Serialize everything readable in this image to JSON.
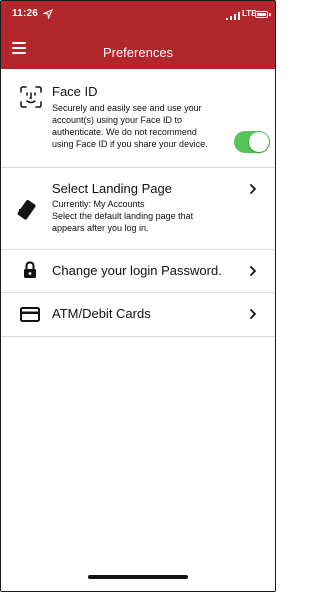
{
  "status_bar": {
    "time": "11:26",
    "network": "LTE"
  },
  "header": {
    "title": "Preferences"
  },
  "face_id": {
    "title": "Face ID",
    "description_lines": [
      "Securely and easily see and use your",
      "account(s) using your Face ID to",
      "authenticate.  We do not recommend",
      "using Face ID if you share your device."
    ],
    "enabled": true
  },
  "landing_page": {
    "title": "Select Landing Page",
    "current": "Currently: My Accounts",
    "description_lines": [
      "Select the default landing page that",
      "appears after you log in."
    ]
  },
  "password": {
    "title": "Change your login Password."
  },
  "cards": {
    "title": "ATM/Debit Cards"
  },
  "icons": {
    "menu": "menu-icon",
    "location": "location-arrow-icon",
    "signal": "signal-icon",
    "battery": "battery-icon",
    "face_id": "face-id-icon",
    "landing": "phone-icon",
    "password": "lock-icon",
    "cards": "credit-card-icon",
    "chevron": "chevron-right-icon"
  },
  "colors": {
    "header": "#b3262b",
    "toggle_on": "#55c55a"
  }
}
